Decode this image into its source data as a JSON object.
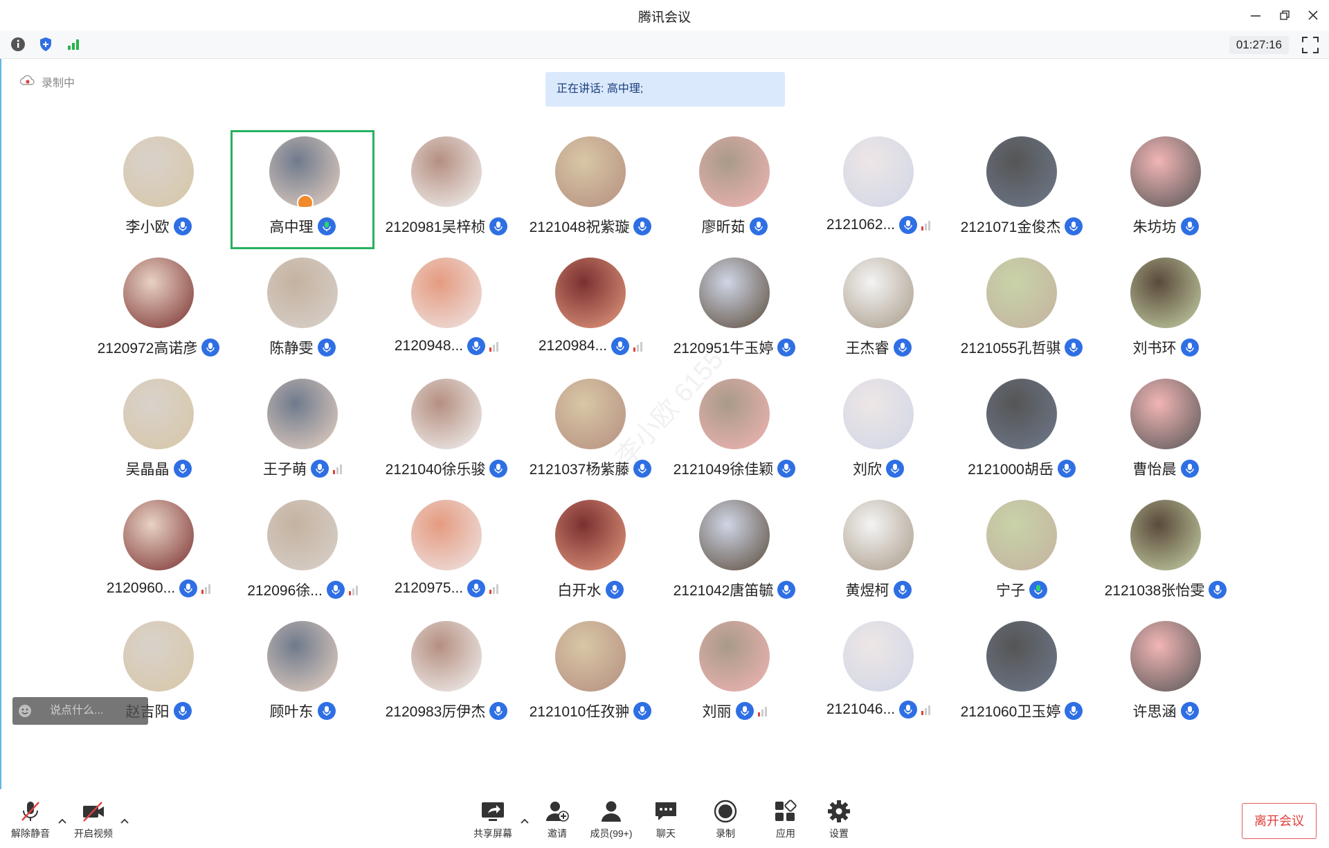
{
  "window": {
    "title": "腾讯会议",
    "controls": [
      "minimize-icon",
      "restore-icon",
      "close-icon"
    ]
  },
  "toolbar": {
    "icons": [
      "info-icon",
      "shield-icon",
      "signal-bars-icon"
    ],
    "timer": "01:27:16"
  },
  "status": {
    "recording_label": "录制中",
    "speaking_text": "正在讲话: 高中理;"
  },
  "colors": {
    "accent": "#2f6fe4",
    "active_border": "#27b05f",
    "leave": "#e23a3a",
    "speaking_bg": "#dbe9fd"
  },
  "participants": [
    {
      "name": "李小欧",
      "mic": "on"
    },
    {
      "name": "高中理",
      "mic": "speaking",
      "active": true,
      "host": true
    },
    {
      "name": "2120981吴梓桢",
      "mic": "on"
    },
    {
      "name": "2121048祝紫璇",
      "mic": "on"
    },
    {
      "name": "廖昕茹",
      "mic": "on"
    },
    {
      "name": "2121062...",
      "mic": "on",
      "weak_signal": true
    },
    {
      "name": "2121071金俊杰",
      "mic": "on"
    },
    {
      "name": "朱坊坊",
      "mic": "on"
    },
    {
      "name": "2120972高诺彦",
      "mic": "on"
    },
    {
      "name": "陈静雯",
      "mic": "on"
    },
    {
      "name": "2120948...",
      "mic": "on",
      "weak_signal": true
    },
    {
      "name": "2120984...",
      "mic": "on",
      "weak_signal": true
    },
    {
      "name": "2120951牛玉婷",
      "mic": "on"
    },
    {
      "name": "王杰睿",
      "mic": "on"
    },
    {
      "name": "2121055孔哲骐",
      "mic": "on"
    },
    {
      "name": "刘书环",
      "mic": "on"
    },
    {
      "name": "吴晶晶",
      "mic": "on"
    },
    {
      "name": "王子萌",
      "mic": "on",
      "weak_signal": true
    },
    {
      "name": "2121040徐乐骏",
      "mic": "on"
    },
    {
      "name": "2121037杨紫藤",
      "mic": "on"
    },
    {
      "name": "2121049徐佳颖",
      "mic": "on"
    },
    {
      "name": "刘欣",
      "mic": "on"
    },
    {
      "name": "2121000胡岳",
      "mic": "on"
    },
    {
      "name": "曹怡晨",
      "mic": "on"
    },
    {
      "name": "2120960...",
      "mic": "on",
      "weak_signal": true
    },
    {
      "name": "212096徐...",
      "mic": "on",
      "weak_signal": true
    },
    {
      "name": "2120975...",
      "mic": "on",
      "weak_signal": true
    },
    {
      "name": "白开水",
      "mic": "on"
    },
    {
      "name": "2121042唐笛毓",
      "mic": "on"
    },
    {
      "name": "黄煜柯",
      "mic": "on"
    },
    {
      "name": "宁子",
      "mic": "speaking"
    },
    {
      "name": "2121038张怡雯",
      "mic": "on"
    },
    {
      "name": "赵吉阳",
      "mic": "on"
    },
    {
      "name": "顾叶东",
      "mic": "on"
    },
    {
      "name": "2120983厉伊杰",
      "mic": "on"
    },
    {
      "name": "2121010任孜翀",
      "mic": "on"
    },
    {
      "name": "刘丽",
      "mic": "on",
      "weak_signal": true
    },
    {
      "name": "2121046...",
      "mic": "on",
      "weak_signal": true
    },
    {
      "name": "2121060卫玉婷",
      "mic": "on"
    },
    {
      "name": "许思涵",
      "mic": "on"
    }
  ],
  "chat": {
    "placeholder": "说点什么..."
  },
  "bottombar": {
    "unmute_label": "解除静音",
    "video_label": "开启视频",
    "share_label": "共享屏幕",
    "invite_label": "邀请",
    "members_label": "成员(99+)",
    "chat_label": "聊天",
    "record_label": "录制",
    "apps_label": "应用",
    "settings_label": "设置",
    "leave_label": "离开会议"
  }
}
